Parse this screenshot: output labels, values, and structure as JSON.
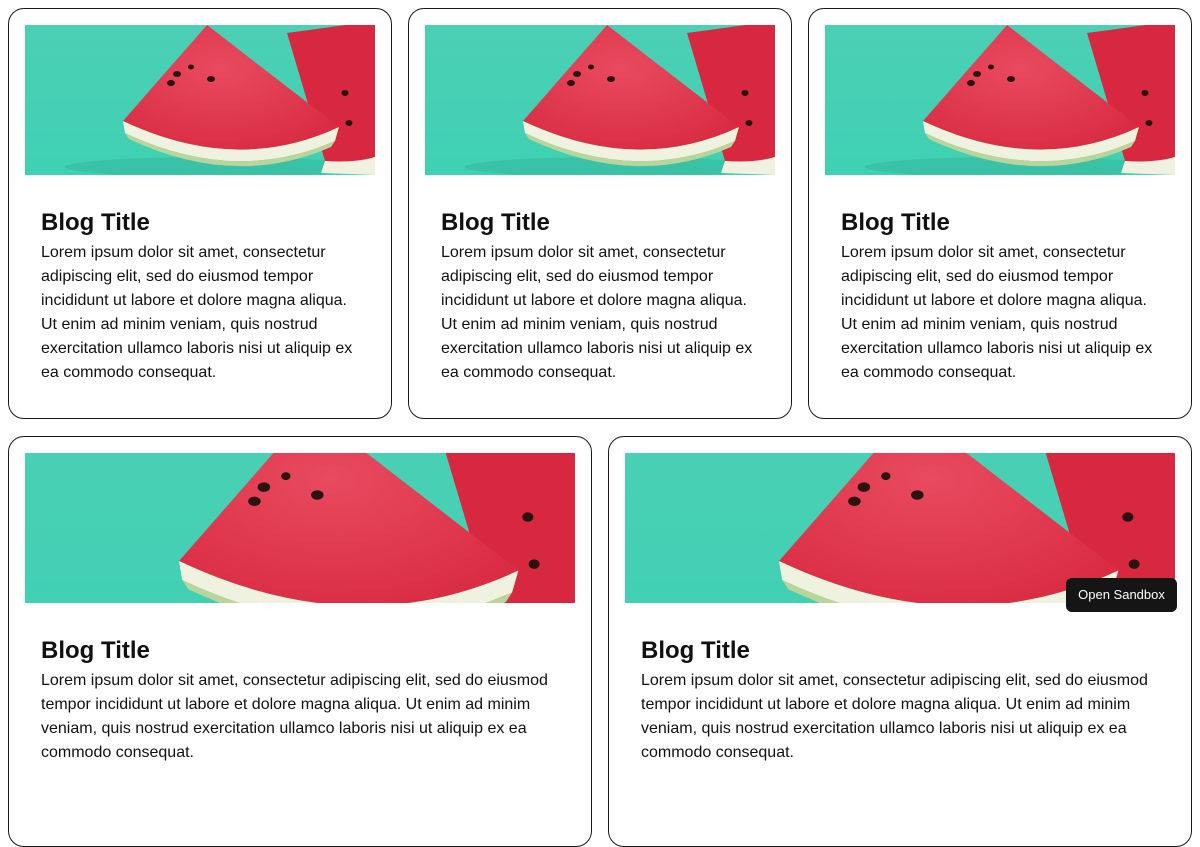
{
  "cards": [
    {
      "title": "Blog Title",
      "text": "Lorem ipsum dolor sit amet, consectetur adipiscing elit, sed do eiusmod tempor incididunt ut labore et dolore magna aliqua. Ut enim ad minim veniam, quis nostrud exercitation ullamco laboris nisi ut aliquip ex ea commodo consequat."
    },
    {
      "title": "Blog Title",
      "text": "Lorem ipsum dolor sit amet, consectetur adipiscing elit, sed do eiusmod tempor incididunt ut labore et dolore magna aliqua. Ut enim ad minim veniam, quis nostrud exercitation ullamco laboris nisi ut aliquip ex ea commodo consequat."
    },
    {
      "title": "Blog Title",
      "text": "Lorem ipsum dolor sit amet, consectetur adipiscing elit, sed do eiusmod tempor incididunt ut labore et dolore magna aliqua. Ut enim ad minim veniam, quis nostrud exercitation ullamco laboris nisi ut aliquip ex ea commodo consequat."
    },
    {
      "title": "Blog Title",
      "text": "Lorem ipsum dolor sit amet, consectetur adipiscing elit, sed do eiusmod tempor incididunt ut labore et dolore magna aliqua. Ut enim ad minim veniam, quis nostrud exercitation ullamco laboris nisi ut aliquip ex ea commodo consequat."
    },
    {
      "title": "Blog Title",
      "text": "Lorem ipsum dolor sit amet, consectetur adipiscing elit, sed do eiusmod tempor incididunt ut labore et dolore magna aliqua. Ut enim ad minim veniam, quis nostrud exercitation ullamco laboris nisi ut aliquip ex ea commodo consequat."
    }
  ],
  "sandbox_button": {
    "label": "Open Sandbox"
  },
  "colors": {
    "image_background": "#3fd1b3",
    "watermelon_flesh": "#d8283f",
    "watermelon_rind": "#eef2df",
    "seed": "#2a1410",
    "button_background": "#151515"
  }
}
